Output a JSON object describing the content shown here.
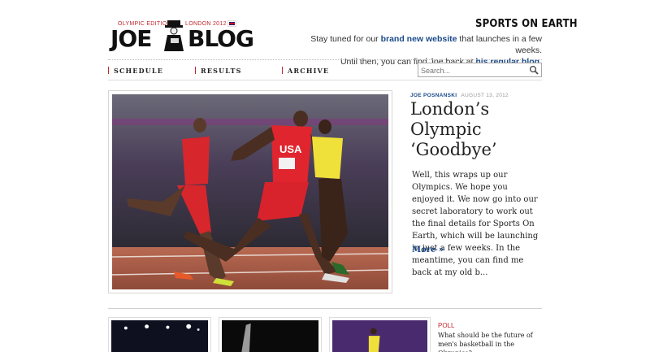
{
  "header": {
    "edition_label": "OLYMPIC EDITION",
    "london_label": "LONDON 2012",
    "logo_left": "JOE",
    "logo_right": "BLOG",
    "sports_logo": "SPORTS ON EARTH",
    "tagline": {
      "line1_prefix": "Stay tuned for our ",
      "line1_link": "brand new website",
      "line1_suffix": " that launches in a few weeks.",
      "line2_prefix": "Until then, you can find Joe back at ",
      "line2_link": "his regular blog",
      "line2_suffix": "."
    }
  },
  "nav": {
    "items": [
      {
        "label": "SCHEDULE"
      },
      {
        "label": "RESULTS"
      },
      {
        "label": "ARCHIVE"
      }
    ],
    "search_placeholder": "Search..."
  },
  "article": {
    "author": "JOE POSNANSKI",
    "date": "AUGUST 13, 2012",
    "title": "London’s Olympic ‘Goodbye’",
    "excerpt": "Well, this wraps up our Olympics. We hope you enjoyed it. We now go into our secret laboratory to work out the final details for Sports On Earth, which will be launching in just a few weeks. In the meantime, you can find me back at my old b...",
    "more_label": "More »"
  },
  "poll": {
    "label": "POLL",
    "question": "What should be the future of men's basketball in the Olympics?"
  },
  "colors": {
    "accent_red": "#c2272d",
    "link_blue": "#1a4a8a"
  }
}
